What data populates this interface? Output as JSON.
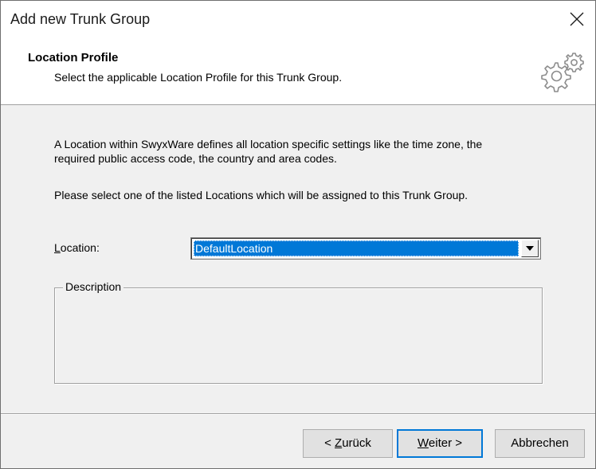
{
  "window": {
    "title": "Add new Trunk Group"
  },
  "header": {
    "title": "Location Profile",
    "subtitle": "Select the applicable Location Profile for this Trunk Group."
  },
  "content": {
    "paragraph1_line1": "A Location within SwyxWare defines all location specific settings like the time zone, the",
    "paragraph1_line2": "required public access code, the country and area codes.",
    "paragraph2": "Please select one of the listed Locations which will be assigned to this Trunk Group."
  },
  "location": {
    "label_accel": "L",
    "label_rest": "ocation:",
    "selected": "DefaultLocation"
  },
  "description": {
    "label": "Description"
  },
  "buttons": {
    "back_prefix": "< ",
    "back_accel": "Z",
    "back_rest": "urück",
    "next_accel": "W",
    "next_rest": "eiter >",
    "cancel": "Abbrechen"
  },
  "icons": {
    "close": "close-icon",
    "gears": "gears-icon",
    "dropdown": "chevron-down-icon"
  }
}
